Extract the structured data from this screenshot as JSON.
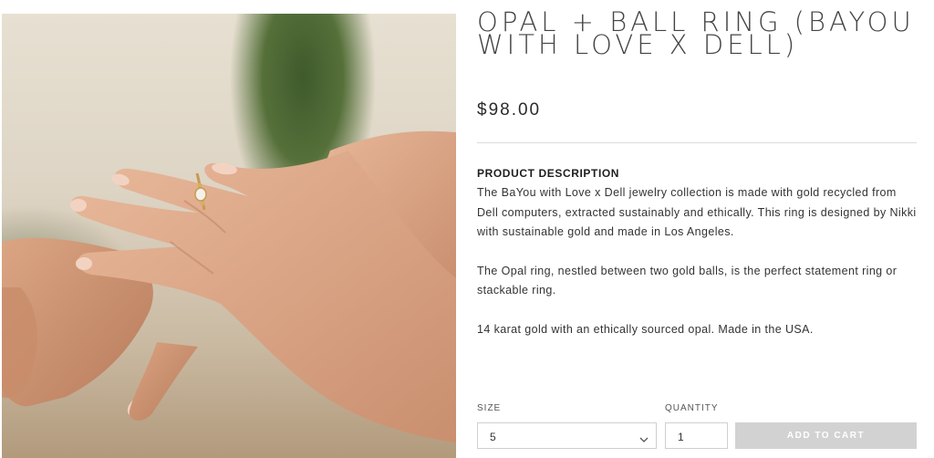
{
  "product": {
    "title": "OPAL + BALL RING (BAYOU WITH LOVE X DELL)",
    "price": "$98.00",
    "description_heading": "PRODUCT DESCRIPTION",
    "description": [
      "The BaYou with Love x Dell jewelry collection is made with gold recycled from Dell computers, extracted sustainably and ethically. This ring is designed by Nikki with sustainable gold and made in Los Angeles.",
      "The Opal ring, nestled between two gold balls, is the perfect statement ring or stackable ring.",
      "14 karat gold with an ethically sourced opal. Made in the USA."
    ]
  },
  "form": {
    "size_label": "SIZE",
    "size_value": "5",
    "quantity_label": "QUANTITY",
    "quantity_value": "1",
    "add_to_cart_label": "ADD TO CART"
  },
  "icons": {
    "size_dropdown": "chevron-down-icon"
  },
  "colors": {
    "button_disabled": "#d2d2d2",
    "divider": "#dcdcdc"
  }
}
